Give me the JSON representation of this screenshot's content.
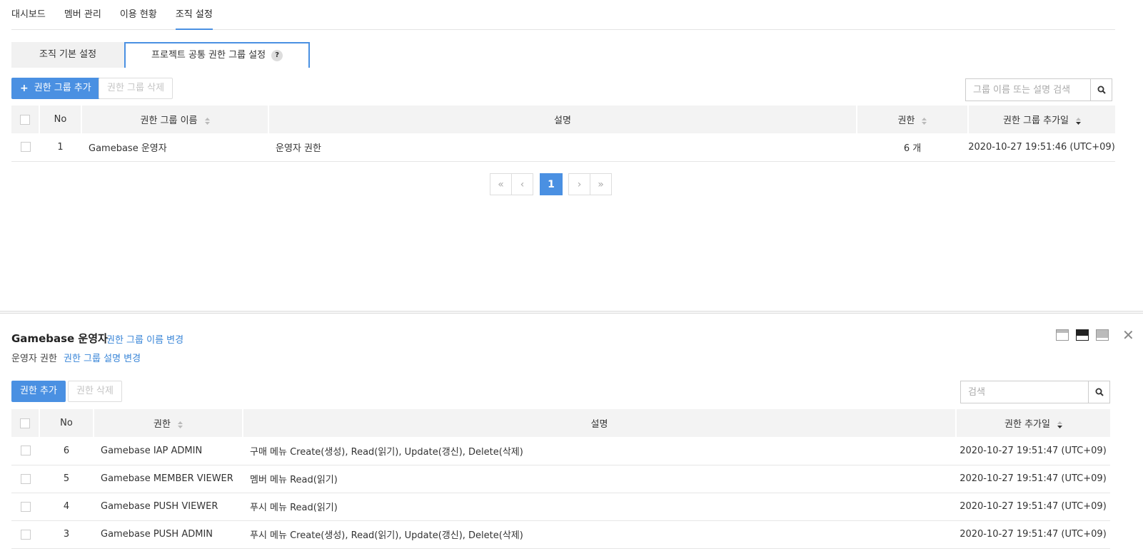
{
  "topnav": {
    "items": [
      {
        "label": "대시보드"
      },
      {
        "label": "멤버 관리"
      },
      {
        "label": "이용 현황"
      },
      {
        "label": "조직 설정"
      }
    ]
  },
  "subtabs": {
    "basic": "조직 기본 설정",
    "project_common": "프로젝트 공통 권한 그룹 설정",
    "help_glyph": "?"
  },
  "toolbar": {
    "add_label": "권한 그룹 추가",
    "add_icon": "+",
    "delete_label": "권한 그룹 삭제",
    "search_placeholder": "그룹 이름 또는 설명 검색"
  },
  "groups_table": {
    "headers": {
      "no": "No",
      "name": "권한 그룹 이름",
      "desc": "설명",
      "perm": "권한",
      "date": "권한 그룹 추가일"
    },
    "rows": [
      {
        "no": "1",
        "name": "Gamebase 운영자",
        "desc": "운영자 권한",
        "perm": "6 개",
        "date": "2020-10-27 19:51:46 (UTC+09)"
      }
    ]
  },
  "pagination": {
    "first": "«",
    "prev": "‹",
    "current": "1",
    "next": "›",
    "last": "»"
  },
  "detail": {
    "title": "Gamebase 운영자",
    "rename_link": "권한 그룹 이름 변경",
    "description": "운영자 권한",
    "desc_link": "권한 그룹 설명 변경",
    "close": "✕",
    "add_label": "권한 추가",
    "delete_label": "권한 삭제",
    "search_placeholder": "검색",
    "headers": {
      "no": "No",
      "perm": "권한",
      "desc": "설명",
      "date": "권한 추가일"
    },
    "rows": [
      {
        "no": "6",
        "perm": "Gamebase IAP ADMIN",
        "desc": "구매 메뉴 Create(생성), Read(읽기), Update(갱신), Delete(삭제)",
        "date": "2020-10-27 19:51:47 (UTC+09)"
      },
      {
        "no": "5",
        "perm": "Gamebase MEMBER VIEWER",
        "desc": "멤버 메뉴 Read(읽기)",
        "date": "2020-10-27 19:51:47 (UTC+09)"
      },
      {
        "no": "4",
        "perm": "Gamebase PUSH VIEWER",
        "desc": "푸시 메뉴 Read(읽기)",
        "date": "2020-10-27 19:51:47 (UTC+09)"
      },
      {
        "no": "3",
        "perm": "Gamebase PUSH ADMIN",
        "desc": "푸시 메뉴 Create(생성), Read(읽기), Update(갱신), Delete(삭제)",
        "date": "2020-10-27 19:51:47 (UTC+09)"
      }
    ]
  },
  "colors": {
    "accent": "#4a90e2",
    "link": "#3a86d8"
  }
}
